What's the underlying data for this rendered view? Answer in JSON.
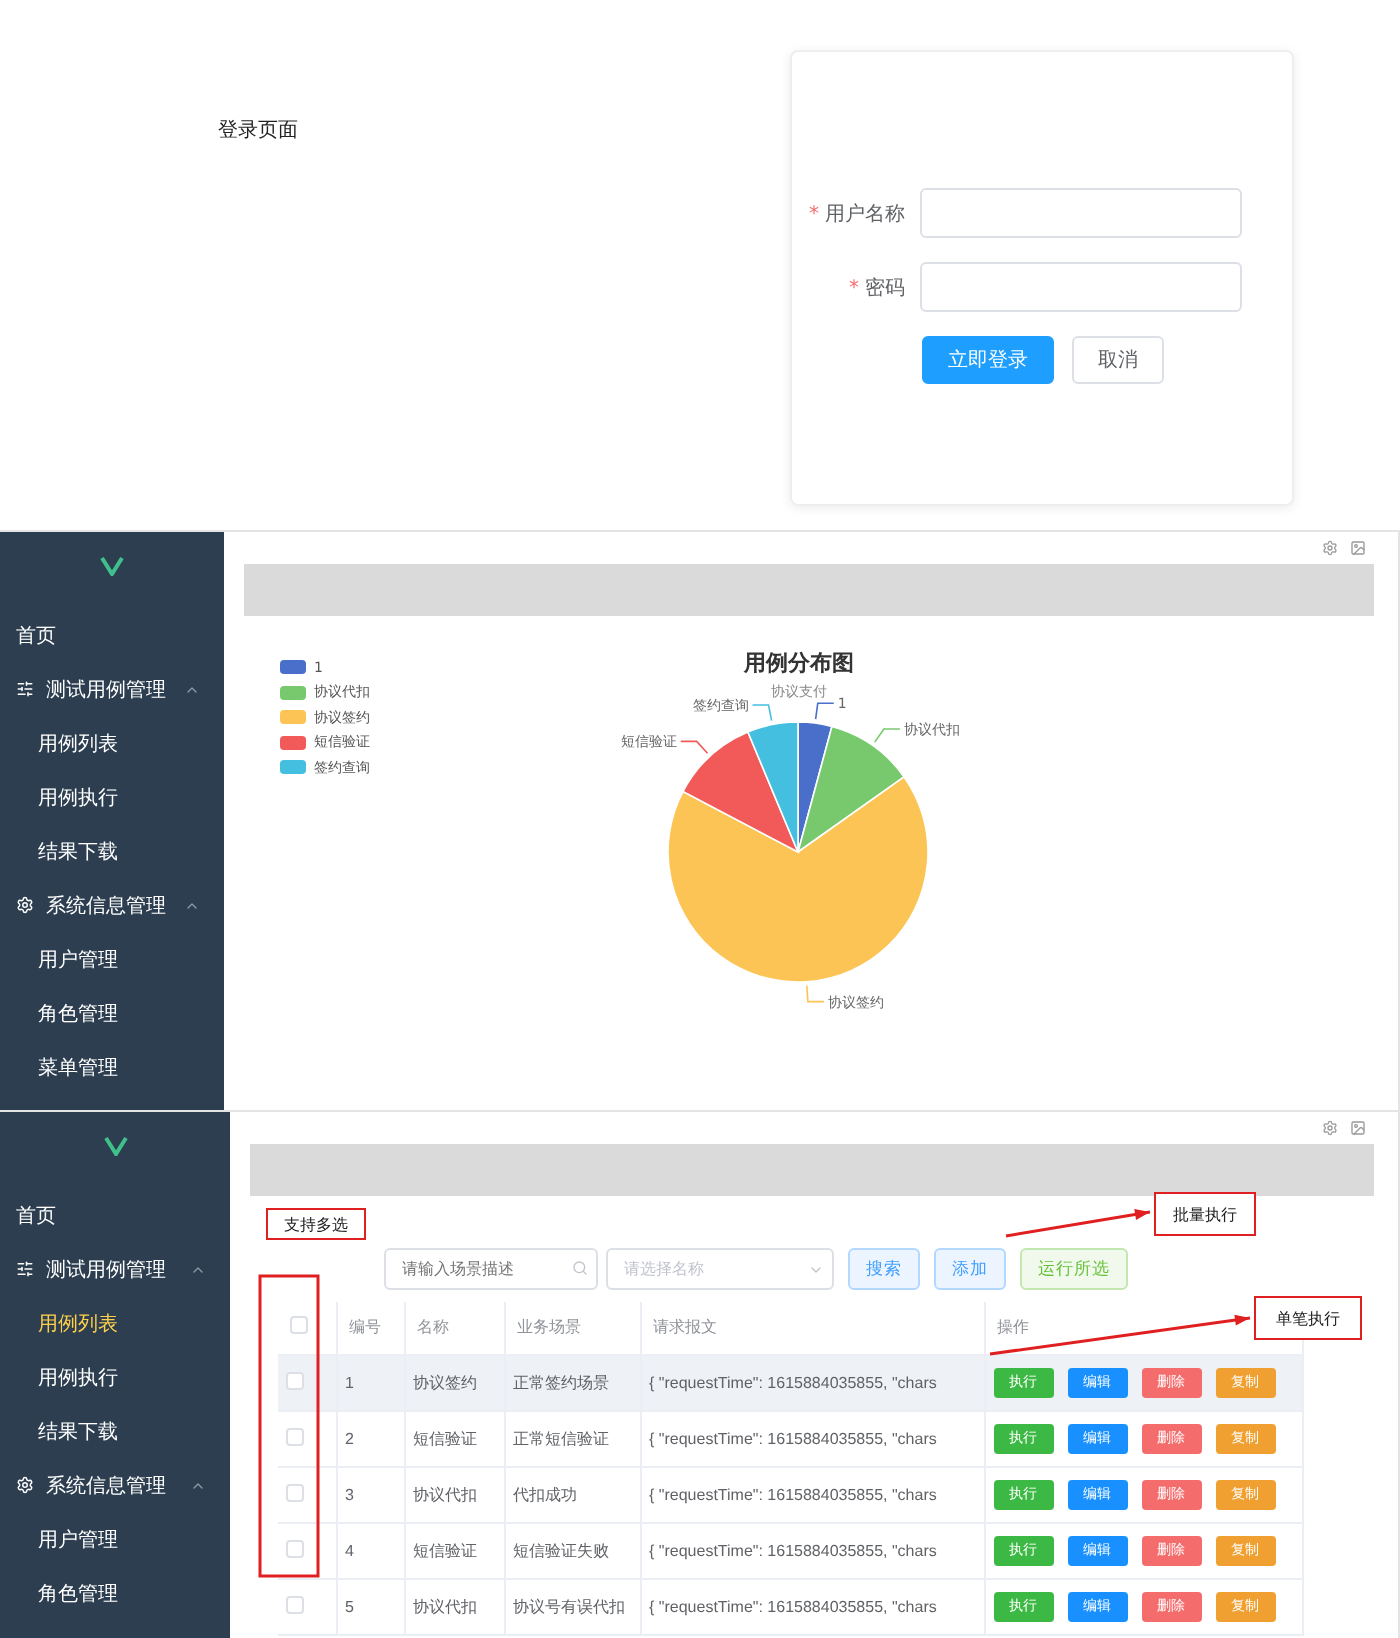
{
  "login_page": {
    "heading": "登录页面",
    "fields": [
      {
        "label": "用户名称",
        "required_mark": "*"
      },
      {
        "label": "密码",
        "required_mark": "*"
      }
    ],
    "buttons": [
      {
        "label": "立即登录",
        "kind": "primary"
      },
      {
        "label": "取消",
        "kind": "default"
      }
    ]
  },
  "chart_page": {
    "sidebar": [
      {
        "kind": "link",
        "label": "首页",
        "selected": false
      },
      {
        "kind": "group",
        "label": "测试用例管理",
        "expanded": true,
        "children": [
          {
            "label": "用例列表",
            "selected": false
          },
          {
            "label": "用例执行",
            "selected": false
          },
          {
            "label": "结果下载",
            "selected": false
          }
        ]
      },
      {
        "kind": "group",
        "label": "系统信息管理",
        "expanded": true,
        "children": [
          {
            "label": "用户管理",
            "selected": false
          },
          {
            "label": "角色管理",
            "selected": false
          },
          {
            "label": "菜单管理",
            "selected": false
          }
        ]
      }
    ],
    "chart": {
      "title": "用例分布图",
      "subtitle": "协议支付",
      "legend": [
        {
          "label": "1",
          "color": "#4a6fcb"
        },
        {
          "label": "协议代扣",
          "color": "#78c96e"
        },
        {
          "label": "协议签约",
          "color": "#fcc454"
        },
        {
          "label": "短信验证",
          "color": "#f25a5a"
        },
        {
          "label": "签约查询",
          "color": "#45bfe0"
        }
      ],
      "slices": [
        {
          "label": "1",
          "color": "#4a6fcb"
        },
        {
          "label": "协议代扣",
          "color": "#78c96e"
        },
        {
          "label": "协议签约",
          "color": "#fcc454"
        },
        {
          "label": "短信验证",
          "color": "#f25a5a"
        },
        {
          "label": "签约查询",
          "color": "#45bfe0"
        }
      ]
    }
  },
  "list_page": {
    "sidebar": [
      {
        "kind": "link",
        "label": "首页",
        "selected": false
      },
      {
        "kind": "group",
        "label": "测试用例管理",
        "expanded": true,
        "children": [
          {
            "label": "用例列表",
            "selected": true
          },
          {
            "label": "用例执行",
            "selected": false
          },
          {
            "label": "结果下载",
            "selected": false
          }
        ]
      },
      {
        "kind": "group",
        "label": "系统信息管理",
        "expanded": true,
        "children": [
          {
            "label": "用户管理",
            "selected": false
          },
          {
            "label": "角色管理",
            "selected": false
          }
        ]
      }
    ],
    "search_field": {
      "placeholder": "请输入场景描述"
    },
    "name_select": {
      "placeholder": "请选择名称"
    },
    "toolbar_buttons": [
      {
        "label": "搜索",
        "kind": "info"
      },
      {
        "label": "添加",
        "kind": "info"
      },
      {
        "label": "运行所选",
        "kind": "success"
      }
    ],
    "table": {
      "columns": [
        "编号",
        "名称",
        "业务场景",
        "请求报文",
        "操作"
      ],
      "header_checked": false,
      "rows": [
        {
          "checked": false,
          "hovered": true,
          "cells": [
            "1",
            "协议签约",
            "正常签约场景",
            "{ \"requestTime\": 1615884035855, \"chars"
          ],
          "actions": [
            {
              "label": "执行",
              "kind": "run"
            },
            {
              "label": "编辑",
              "kind": "edit"
            },
            {
              "label": "删除",
              "kind": "delete"
            },
            {
              "label": "复制",
              "kind": "copy"
            }
          ]
        },
        {
          "checked": false,
          "hovered": false,
          "cells": [
            "2",
            "短信验证",
            "正常短信验证",
            "{ \"requestTime\": 1615884035855, \"chars"
          ],
          "actions": [
            {
              "label": "执行",
              "kind": "run"
            },
            {
              "label": "编辑",
              "kind": "edit"
            },
            {
              "label": "删除",
              "kind": "delete"
            },
            {
              "label": "复制",
              "kind": "copy"
            }
          ]
        },
        {
          "checked": false,
          "hovered": false,
          "cells": [
            "3",
            "协议代扣",
            "代扣成功",
            "{ \"requestTime\": 1615884035855, \"chars"
          ],
          "actions": [
            {
              "label": "执行",
              "kind": "run"
            },
            {
              "label": "编辑",
              "kind": "edit"
            },
            {
              "label": "删除",
              "kind": "delete"
            },
            {
              "label": "复制",
              "kind": "copy"
            }
          ]
        },
        {
          "checked": false,
          "hovered": false,
          "cells": [
            "4",
            "短信验证",
            "短信验证失败",
            "{ \"requestTime\": 1615884035855, \"chars"
          ],
          "actions": [
            {
              "label": "执行",
              "kind": "run"
            },
            {
              "label": "编辑",
              "kind": "edit"
            },
            {
              "label": "删除",
              "kind": "delete"
            },
            {
              "label": "复制",
              "kind": "copy"
            }
          ]
        },
        {
          "checked": false,
          "hovered": false,
          "cells": [
            "5",
            "协议代扣",
            "协议号有误代扣",
            "{ \"requestTime\": 1615884035855, \"chars"
          ],
          "actions": [
            {
              "label": "执行",
              "kind": "run"
            },
            {
              "label": "编辑",
              "kind": "edit"
            },
            {
              "label": "删除",
              "kind": "delete"
            },
            {
              "label": "复制",
              "kind": "copy"
            }
          ]
        }
      ]
    },
    "annotations": {
      "multi_select_note": "支持多选",
      "batch_note": "批量执行",
      "single_note": "单笔执行"
    }
  }
}
